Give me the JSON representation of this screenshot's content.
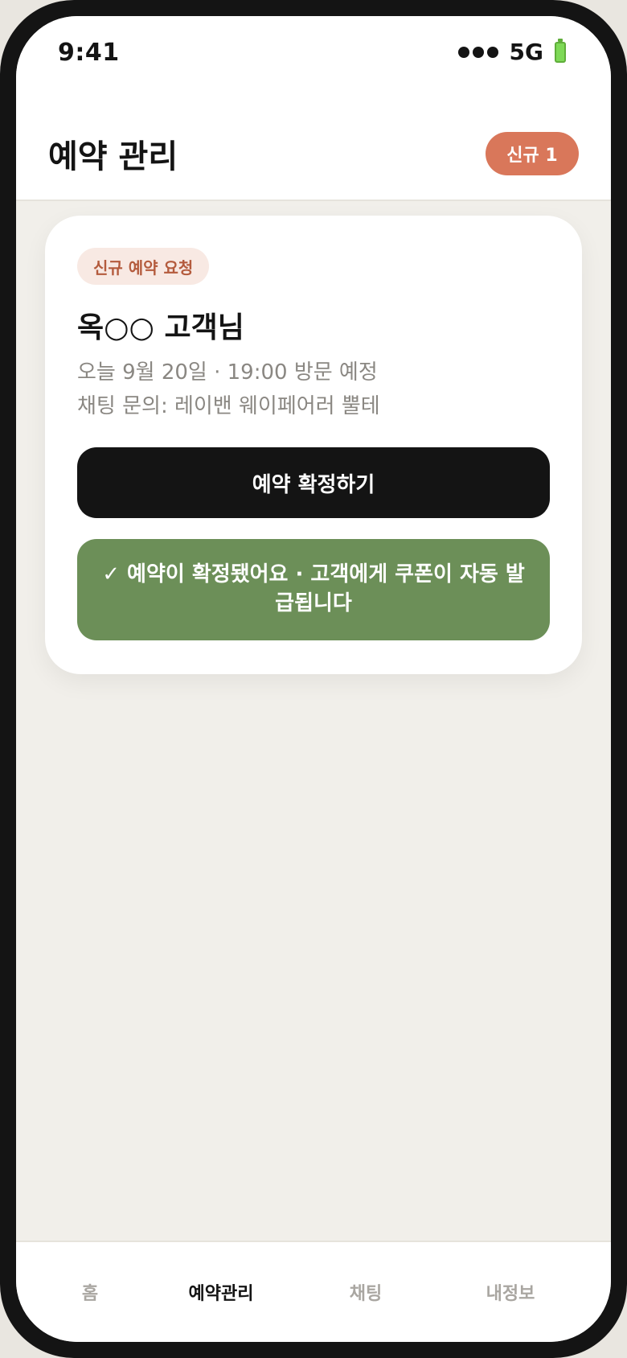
{
  "status_bar": {
    "time": "9:41",
    "network": "5G",
    "icons": [
      "signal-dots-icon",
      "battery-icon"
    ]
  },
  "header": {
    "title": "예약 관리",
    "new_badge": "신규 1"
  },
  "card": {
    "chip": "신규 예약 요청",
    "customer_name": "옥○○ 고객님",
    "visit_info": "오늘 9월 20일 · 19:00 방문 예정",
    "chat_info": "채팅 문의: 레이밴 웨이페어러 뿔테",
    "confirm_button": "예약 확정하기",
    "confirmed_message": "✓ 예약이 확정됐어요 · 고객에게 쿠폰이 자동 발급됩니다"
  },
  "tab_bar": {
    "tabs": [
      {
        "label": "홈",
        "active": false
      },
      {
        "label": "예약관리",
        "active": true
      },
      {
        "label": "채팅",
        "active": false
      },
      {
        "label": "내정보",
        "active": false
      }
    ]
  },
  "colors": {
    "accent": "#d9775a",
    "chip_bg": "#f8e9e3",
    "chip_text": "#b45b3d",
    "primary_button": "#141414",
    "success": "#6c8f58",
    "background": "#f1efea"
  }
}
